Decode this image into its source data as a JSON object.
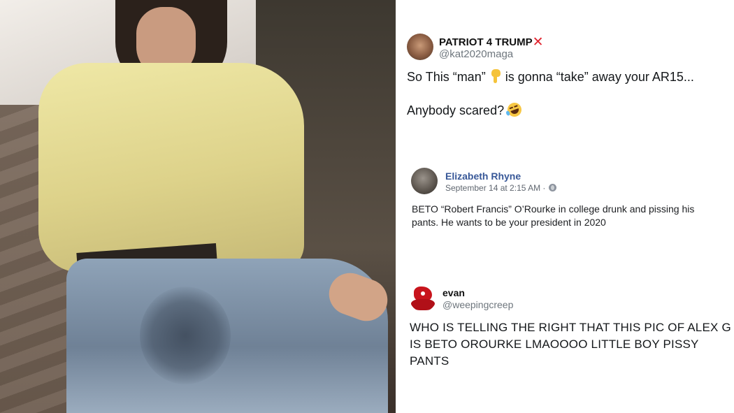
{
  "tweet_patriot": {
    "name": "PATRIOT 4 TRUMP",
    "name_mark": "✕",
    "handle": "@kat2020maga",
    "text_part1": "So This “man”",
    "text_part2": "is gonna “take” away your AR15...",
    "text_line2": "Anybody scared?"
  },
  "post_elizabeth": {
    "name": "Elizabeth Rhyne",
    "meta": "September 14 at 2:15 AM ·",
    "text": "BETO “Robert Francis” O’Rourke in college drunk and pissing his pants. He wants to be your president in 2020"
  },
  "tweet_evan": {
    "name": "evan",
    "handle": "@weepingcreep",
    "text": "WHO IS TELLING THE RIGHT THAT THIS PIC OF ALEX G IS BETO OROURKE LMAOOOO LITTLE BOY PISSY PANTS"
  },
  "icons": [
    "pointing-down-emoji-icon",
    "rolling-laughing-emoji-icon",
    "globe-icon",
    "x-mark-icon"
  ],
  "colors": {
    "x_mark": "#e0242f",
    "facebook_name": "#385898",
    "handle_gray": "#6e767d"
  }
}
